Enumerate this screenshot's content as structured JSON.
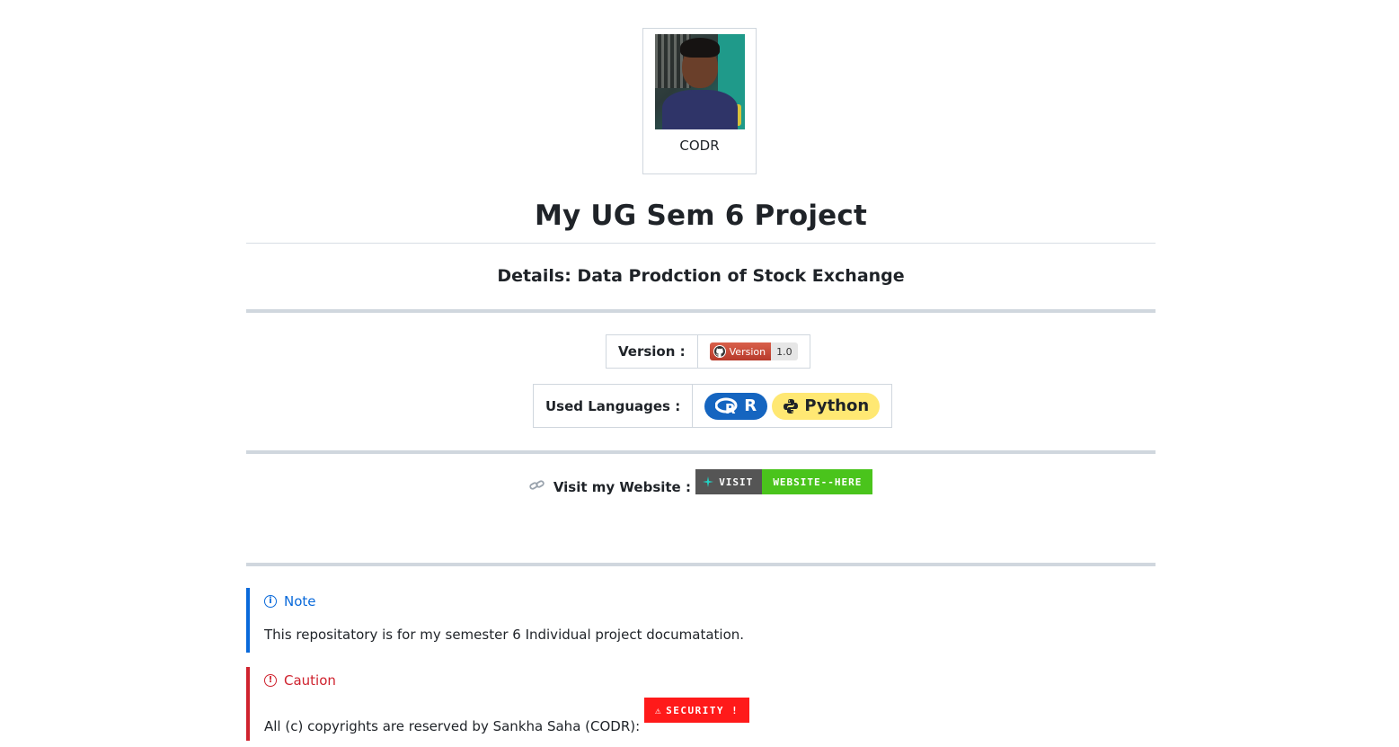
{
  "avatar": {
    "caption": "CODR"
  },
  "title": "My UG Sem 6 Project",
  "subtitle": "Details: Data Prodction of Stock Exchange",
  "version": {
    "label": "Version :",
    "badge_left": "Version",
    "badge_right": "1.0",
    "icon": "github-icon"
  },
  "languages": {
    "label": "Used Languages :",
    "badges": [
      {
        "name": "R",
        "icon": "r-logo-icon",
        "color": "#1565c0"
      },
      {
        "name": "Python",
        "icon": "python-logo-icon",
        "color": "#ffe873"
      }
    ]
  },
  "website": {
    "label": "Visit my Website :",
    "icon": "link-icon",
    "badge_left": "VISIT",
    "badge_right": "WEBSITE--HERE",
    "badge_left_color": "#555555",
    "badge_right_color": "#4ac41c"
  },
  "note": {
    "title": "Note",
    "icon": "info-icon",
    "text": "This repositatory is for my semester 6 Individual project documatation.",
    "color": "#0969da"
  },
  "caution": {
    "title": "Caution",
    "icon": "alert-icon",
    "text": "All (c) copyrights are reserved by Sankha Saha (CODR):",
    "badge": "SECURITY !",
    "color": "#cf222e"
  }
}
